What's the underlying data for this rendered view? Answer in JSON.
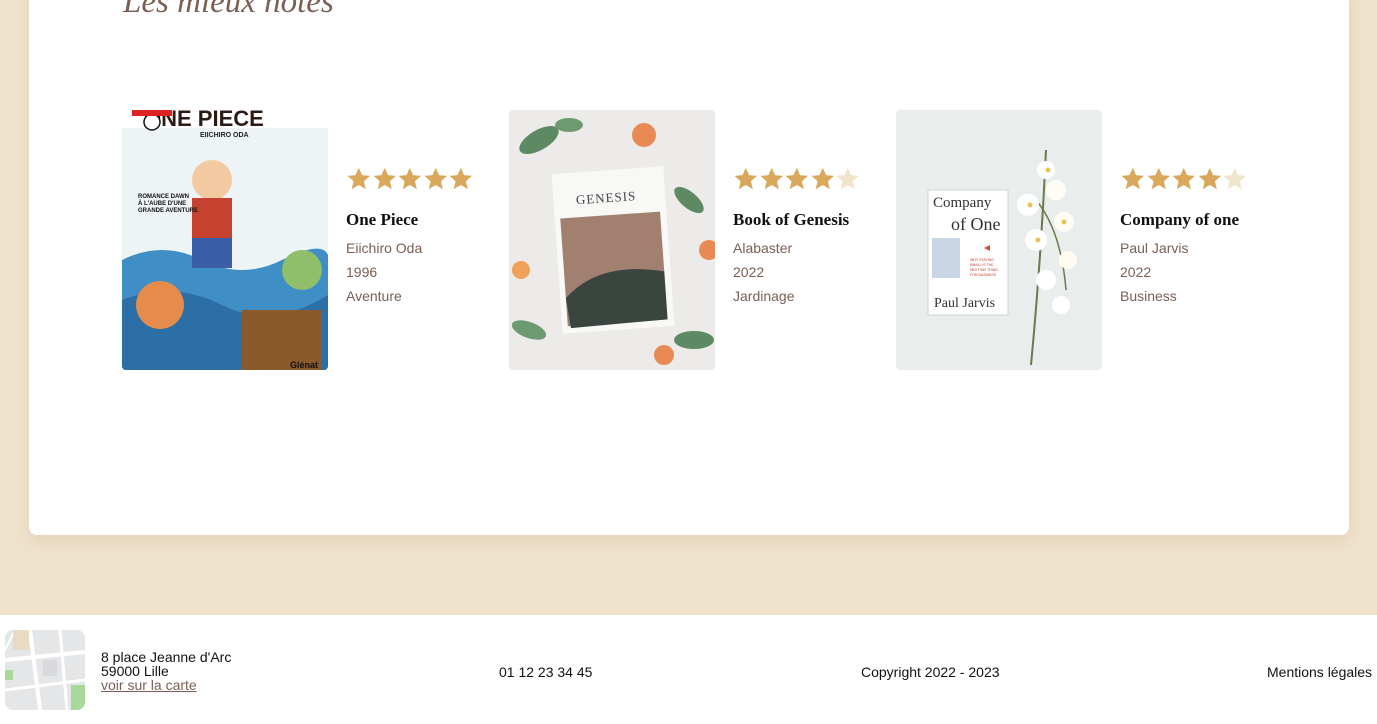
{
  "section": {
    "title": "Les mieux notés"
  },
  "colors": {
    "star_filled": "#d9a85b",
    "star_empty": "#f1e4cc",
    "accent_text": "#7a5f52",
    "page_bg": "#f0e3cc"
  },
  "books": [
    {
      "title": "One Piece",
      "author": "Eiichiro Oda",
      "year": "1996",
      "genre": "Aventure",
      "rating": 5,
      "max_rating": 5,
      "cover_text": [
        "ONE PIECE",
        "EIICHIRO ODA",
        "ROMANCE DAWN",
        "À L'AUBE D'UNE",
        "GRANDE AVENTURE",
        "Glénat"
      ]
    },
    {
      "title": "Book of Genesis",
      "author": "Alabaster",
      "year": "2022",
      "genre": "Jardinage",
      "rating": 4,
      "max_rating": 5,
      "cover_text": [
        "GENESIS"
      ]
    },
    {
      "title": "Company of one",
      "author": "Paul Jarvis",
      "year": "2022",
      "genre": "Business",
      "rating": 4,
      "max_rating": 5,
      "cover_text": [
        "Company",
        "of One",
        "WHY STAYING",
        "SMALL IS THE",
        "NEXT BIG THING",
        "FOR BUSINESS",
        "Paul Jarvis"
      ]
    }
  ],
  "footer": {
    "address_line1": "8 place Jeanne d'Arc",
    "address_line2": "59000 Lille",
    "map_link": "voir sur la carte",
    "phone": "01 12 23 34 45",
    "copyright": "Copyright 2022 - 2023",
    "legal": "Mentions légales"
  }
}
